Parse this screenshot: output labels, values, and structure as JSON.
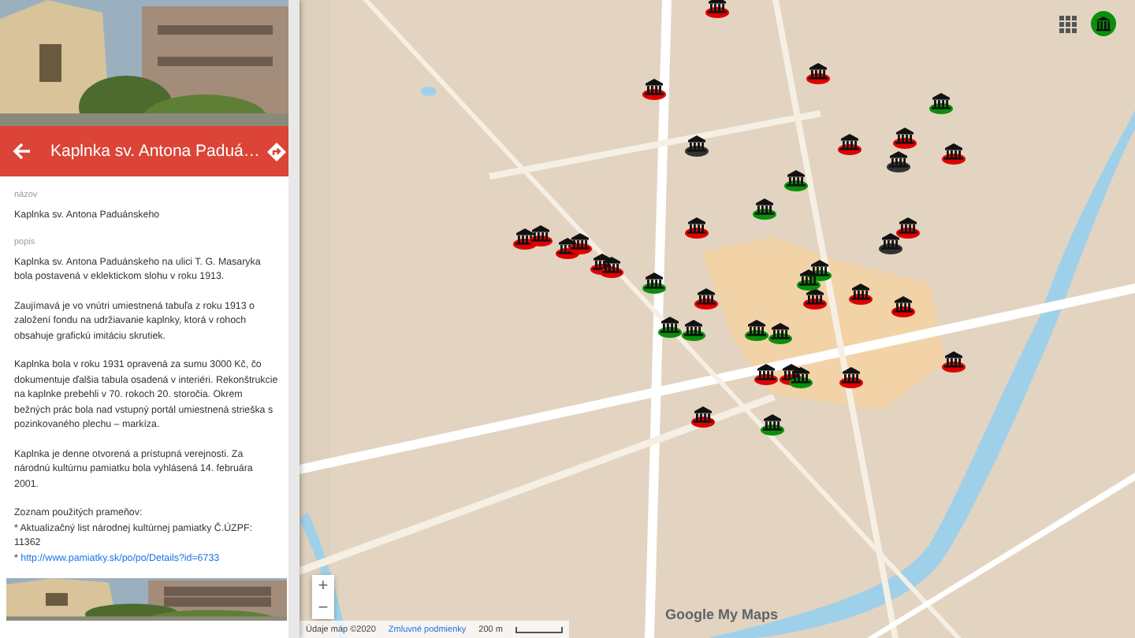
{
  "panel": {
    "header": {
      "title": "Kaplnka sv. Antona Paduá…"
    },
    "fields": [
      {
        "label": "názov",
        "paragraphs": [
          "Kaplnka sv. Antona Paduánskeho"
        ]
      },
      {
        "label": "popis",
        "paragraphs": [
          "Kaplnka sv. Antona Paduánskeho na ulici T. G. Masaryka bola postavená v eklektickom slohu v roku 1913.",
          "Zaujímavá je vo vnútri umiestnená tabuľa z roku 1913 o založení fondu na udržiavanie kaplnky, ktorá v rohoch obsahuje grafickú imitáciu skrutiek.",
          "Kaplnka bola v roku 1931 opravená za sumu 3000 Kč, čo dokumentuje ďalšia tabula osadená v interiéri. Rekonštrukcie na kaplnke prebehli v 70. rokoch 20. storočia. Okrem bežných prác bola nad vstupný portál umiestnená strieška s pozinkovaného plechu – markíza.",
          "Kaplnka je denne otvorená a prístupná verejnosti. Za národnú kultúrnu pamiatku bola vyhlásená 14. februára 2001."
        ]
      }
    ],
    "sources": [
      {
        "kind": "text",
        "text": "Zoznam použitých prameňov:"
      },
      {
        "kind": "text",
        "text": "* Aktualizačný list národnej kultúrnej pamiatky Č.ÚZPF: 11362"
      },
      {
        "kind": "link",
        "bullet": "*",
        "text": "http://www.pamiatky.sk/po/po/Details?id=6733"
      }
    ]
  },
  "map": {
    "markers": [
      {
        "color": "#e00000"
      },
      {
        "color": "#e00000"
      },
      {
        "color": "#e00000"
      },
      {
        "color": "#e00000"
      },
      {
        "color": "#e00000"
      },
      {
        "color": "#e00000"
      },
      {
        "color": "#e00000"
      },
      {
        "color": "#e00000"
      },
      {
        "color": "#e00000"
      },
      {
        "color": "#e00000"
      },
      {
        "color": "#e00000"
      },
      {
        "color": "#e00000"
      },
      {
        "color": "#e00000"
      },
      {
        "color": "#e00000"
      },
      {
        "color": "#e00000"
      },
      {
        "color": "#e00000"
      },
      {
        "color": "#e00000"
      },
      {
        "color": "#e00000"
      },
      {
        "color": "#e00000"
      },
      {
        "color": "#e00000"
      },
      {
        "color": "#e00000"
      },
      {
        "color": "#e00000"
      },
      {
        "color": "#e00000"
      },
      {
        "color": "#0a8f0a"
      },
      {
        "color": "#0a8f0a"
      },
      {
        "color": "#0a8f0a"
      },
      {
        "color": "#0a8f0a"
      },
      {
        "color": "#0a8f0a"
      },
      {
        "color": "#0a8f0a"
      },
      {
        "color": "#0a8f0a"
      },
      {
        "color": "#0a8f0a"
      },
      {
        "color": "#0a8f0a"
      },
      {
        "color": "#0a8f0a"
      },
      {
        "color": "#0a8f0a"
      },
      {
        "color": "#0a8f0a"
      },
      {
        "color": "#333333"
      },
      {
        "color": "#333333"
      },
      {
        "color": "#333333"
      }
    ],
    "zoom_in": "+",
    "zoom_out": "−",
    "logo": "Google My Maps",
    "attribution": "Údaje máp ©2020",
    "terms": "Zmluvné podmienky",
    "scale": "200 m"
  }
}
